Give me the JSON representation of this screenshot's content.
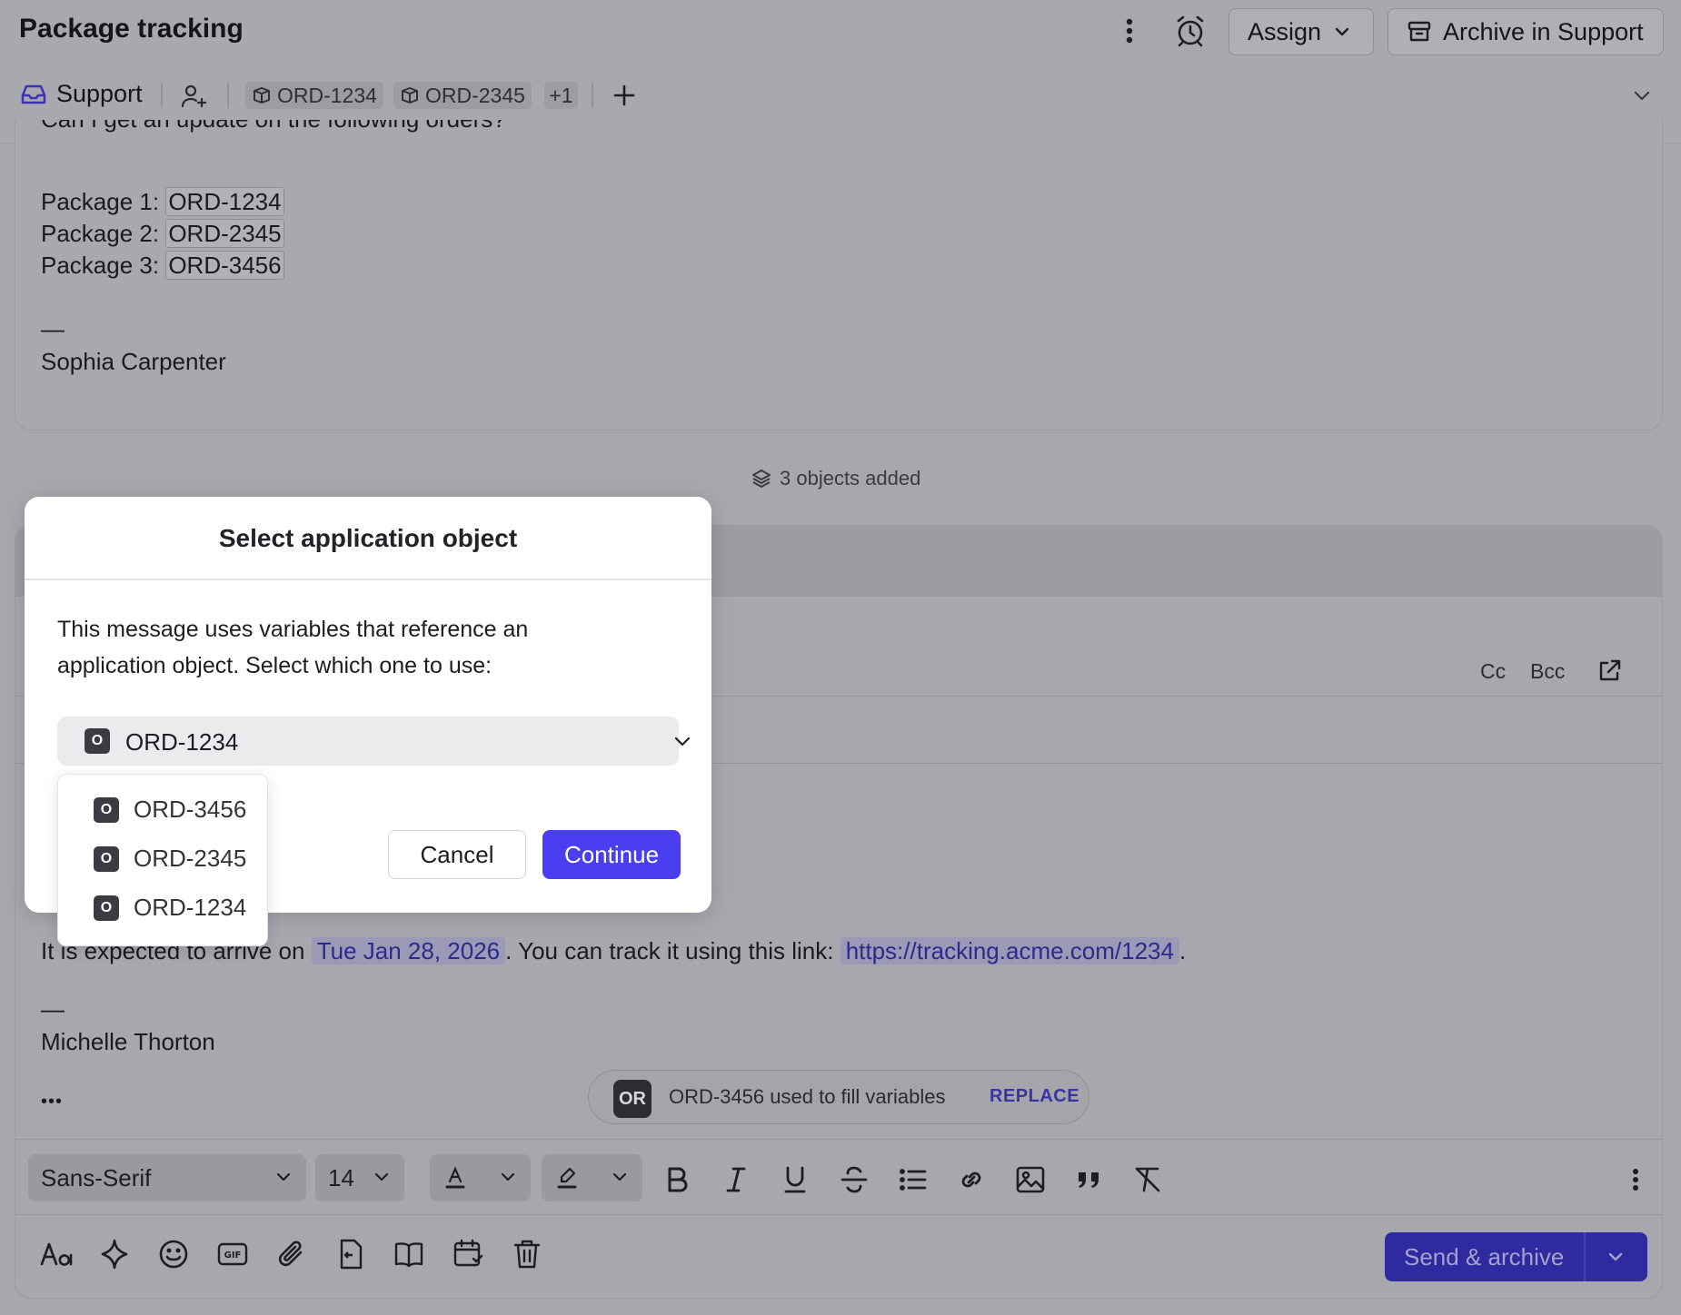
{
  "header": {
    "title": "Package tracking",
    "assign_label": "Assign",
    "archive_label": "Archive in Support"
  },
  "subbar": {
    "inbox_label": "Support",
    "chips": [
      "ORD-1234",
      "ORD-2345"
    ],
    "more_count": "+1"
  },
  "message1": {
    "partial_line": "Can I get an update on the following orders?",
    "packages": [
      {
        "label": "Package 1: ",
        "order": "ORD-1234"
      },
      {
        "label": "Package 2: ",
        "order": "ORD-2345"
      },
      {
        "label": "Package 3: ",
        "order": "ORD-3456"
      }
    ],
    "sig_dash": "—",
    "signature": "Sophia Carpenter"
  },
  "objects_added": "3 objects added",
  "composer": {
    "cc": "Cc",
    "bcc": "Bcc",
    "body_prefix": "It is expected to arrive on ",
    "date": "Tue Jan 28, 2026",
    "body_middle": ". You can track it using this link: ",
    "link": "https://tracking.acme.com/1234",
    "body_suffix": ".",
    "sig_dash": "—",
    "signature": "Michelle Thorton",
    "ellipsis": "•••",
    "fill_badge": "OR",
    "fill_text": "ORD-3456 used to fill variables",
    "replace_label": "REPLACE",
    "font_family": "Sans-Serif",
    "font_size": "14",
    "send_label": "Send & archive"
  },
  "modal": {
    "title": "Select application object",
    "description": "This message uses variables that reference an application object. Select which one to use:",
    "selected": "ORD-1234",
    "object_icon": "O",
    "options": [
      "ORD-3456",
      "ORD-2345",
      "ORD-1234"
    ],
    "cancel_label": "Cancel",
    "continue_label": "Continue"
  },
  "colors": {
    "accent": "#4a3ff0",
    "overlay": "#a8a7ad"
  }
}
